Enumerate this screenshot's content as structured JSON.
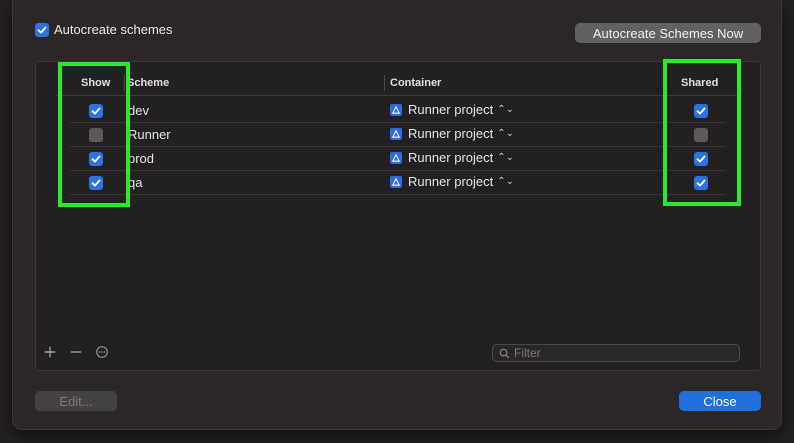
{
  "dialog": {
    "autocreate_label": "Autocreate schemes",
    "autocreate_checked": true,
    "autocreate_now_label": "Autocreate Schemes Now",
    "edit_label": "Edit...",
    "close_label": "Close"
  },
  "table": {
    "columns": {
      "show": "Show",
      "scheme": "Scheme",
      "container": "Container",
      "shared": "Shared"
    },
    "rows": [
      {
        "show": true,
        "scheme": "dev",
        "container": "Runner project",
        "shared": true
      },
      {
        "show": false,
        "scheme": "Runner",
        "container": "Runner project",
        "shared": false
      },
      {
        "show": true,
        "scheme": "prod",
        "container": "Runner project",
        "shared": true
      },
      {
        "show": true,
        "scheme": "qa",
        "container": "Runner project",
        "shared": true
      }
    ]
  },
  "filter": {
    "placeholder": "Filter"
  },
  "icons": {
    "add": "plus-icon",
    "remove": "minus-icon",
    "more": "ellipsis-circle-icon",
    "filter": "search-icon",
    "container": "app-project-icon",
    "stepper": "chevron-updown-icon"
  },
  "colors": {
    "accent": "#2b73e0",
    "highlight": "#2ee62e",
    "sheet_bg": "#2b2727"
  }
}
